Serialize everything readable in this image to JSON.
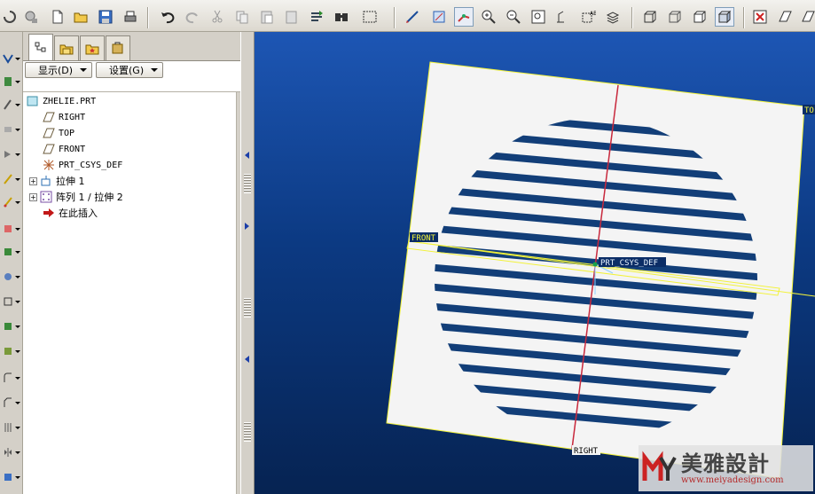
{
  "navigator": {
    "show_menu": "显示(D)",
    "settings_menu": "设置(G)",
    "tree": [
      {
        "label": "ZHELIE.PRT",
        "icon": "part-icon"
      },
      {
        "label": "RIGHT",
        "icon": "datum-plane-icon"
      },
      {
        "label": "TOP",
        "icon": "datum-plane-icon"
      },
      {
        "label": "FRONT",
        "icon": "datum-plane-icon"
      },
      {
        "label": "PRT_CSYS_DEF",
        "icon": "coordinate-system-icon"
      },
      {
        "label": "拉伸 1",
        "icon": "extrude-icon",
        "expandable": true
      },
      {
        "label": "阵列 1 / 拉伸 2",
        "icon": "pattern-icon",
        "expandable": true
      },
      {
        "label": "在此插入",
        "icon": "insert-here-arrow-icon"
      }
    ]
  },
  "viewport": {
    "labels": {
      "front": "FRONT",
      "right": "RIGHT",
      "top": "TO",
      "csys": "PRT_CSYS_DEF"
    },
    "colors": {
      "background_top": "#1d56b4",
      "background_bottom": "#062352",
      "datum_yellow": "#f2f23a",
      "axis_red": "#c8283c",
      "plate": "#f4f4f4",
      "slot": "#123e78"
    }
  },
  "watermark": {
    "title": "美雅設計",
    "url": "www.meiyadesign.com"
  }
}
